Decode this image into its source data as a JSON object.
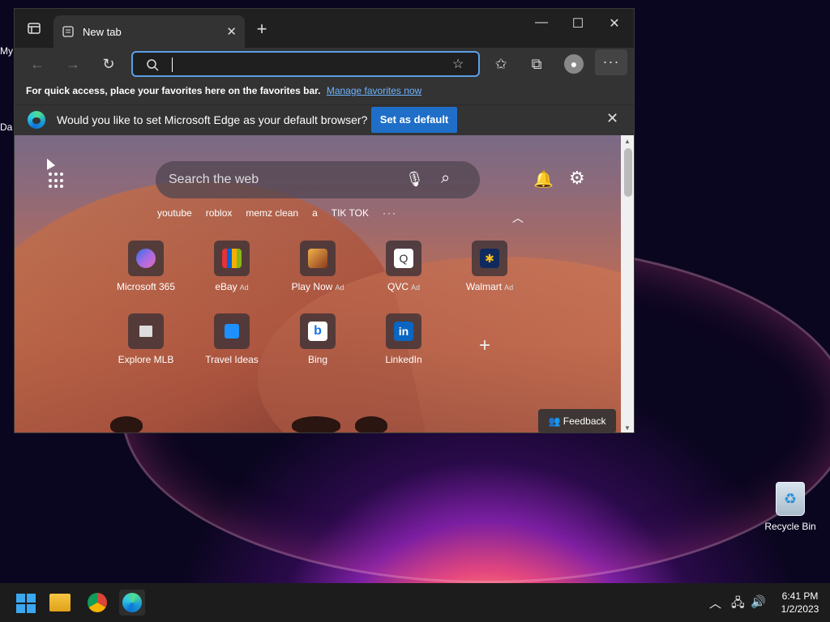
{
  "desktop": {
    "left_labels": [
      "My",
      "Da"
    ],
    "recycle_bin": "Recycle Bin"
  },
  "browser": {
    "tab_title": "New tab",
    "window_controls": [
      "minimize-icon",
      "maximize-icon",
      "close-icon"
    ],
    "favorites_bar": {
      "text": "For quick access, place your favorites here on the favorites bar.",
      "link": "Manage favorites now"
    },
    "default_prompt": {
      "text": "Would you like to set Microsoft Edge as your default browser?",
      "button": "Set as default"
    },
    "address_bar": {
      "value": "",
      "placeholder": ""
    },
    "new_tab_page": {
      "search_placeholder": "Search the web",
      "quick_links": [
        "youtube",
        "roblox",
        "memz clean",
        "a",
        "TIK TOK"
      ],
      "tiles_row1": [
        {
          "label": "Microsoft 365",
          "ad": "",
          "color": "#5b5fc7"
        },
        {
          "label": "eBay",
          "ad": "Ad",
          "color": "#e53238"
        },
        {
          "label": "Play Now",
          "ad": "Ad",
          "color": "#d3822f"
        },
        {
          "label": "QVC",
          "ad": "Ad",
          "color": "#ffffff"
        },
        {
          "label": "Walmart",
          "ad": "Ad",
          "color": "#0071ce"
        }
      ],
      "tiles_row2": [
        {
          "label": "Explore MLB",
          "color": "#cccccc"
        },
        {
          "label": "Travel Ideas",
          "color": "#1e90ff"
        },
        {
          "label": "Bing",
          "color": "#ffffff"
        },
        {
          "label": "LinkedIn",
          "color": "#0a66c2"
        }
      ],
      "feedback": "Feedback"
    }
  },
  "taskbar": {
    "apps": [
      "windows-start-icon",
      "file-explorer-icon",
      "chrome-icon",
      "edge-icon"
    ],
    "time": "6:41 PM",
    "date": "1/2/2023"
  }
}
